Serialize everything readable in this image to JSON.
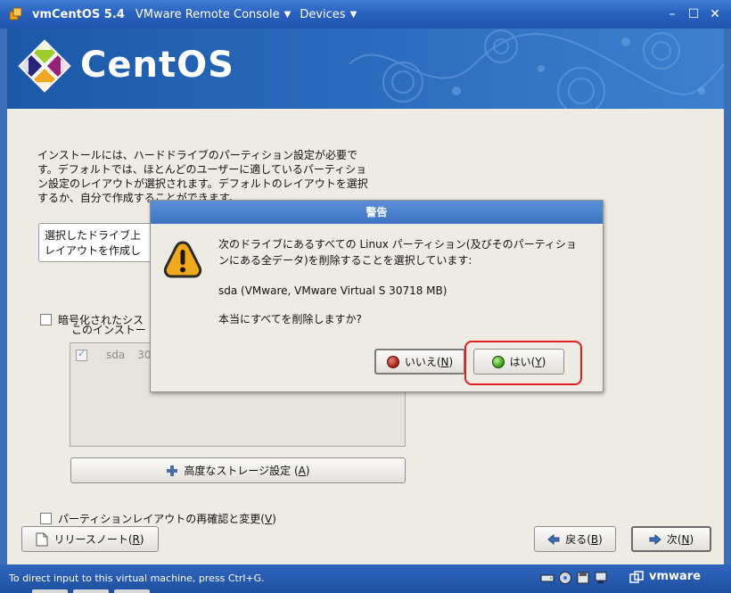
{
  "window": {
    "title": "vmCentOS 5.4",
    "menus": [
      {
        "label": "VMware Remote Console"
      },
      {
        "label": "Devices"
      }
    ]
  },
  "banner": {
    "logo_text": "CentOS"
  },
  "installer": {
    "description": "インストールには、ハードドライブのパーティション設定が必要です。デフォルトでは、ほとんどのユーザーに適しているパーティション設定のレイアウトが選択されます。デフォルトのレイアウトを選択するか、自分で作成することができます。",
    "layout_combo_line1": "選択したドライブ上",
    "layout_combo_line2": "レイアウトを作成し",
    "encrypt_label": "暗号化されたシス",
    "drive_frame_label": "このインストー",
    "drive_row": {
      "name": "sda",
      "size": "30"
    },
    "advanced_storage_label": "高度なストレージ設定",
    "advanced_storage_key": "A",
    "review_label": "パーティションレイアウトの再確認と変更",
    "review_key": "V",
    "release_notes_label": "リリースノート",
    "release_notes_key": "R",
    "back_label": "戻る",
    "back_key": "B",
    "next_label": "次",
    "next_key": "N"
  },
  "dialog": {
    "title": "警告",
    "message": "次のドライブにあるすべての Linux パーティション(及びそのパーティションにある全データ)を削除することを選択しています:",
    "device": "sda (VMware, VMware Virtual S 30718 MB)",
    "confirm": "本当にすべてを削除しますか?",
    "no_label": "いいえ",
    "no_key": "N",
    "yes_label": "はい",
    "yes_key": "Y"
  },
  "statusbar": {
    "hint": "To direct input to this virtual machine, press Ctrl+G.",
    "brand": "vmware"
  },
  "colors": {
    "accent": "#3e74c4",
    "highlight": "#e02020"
  }
}
